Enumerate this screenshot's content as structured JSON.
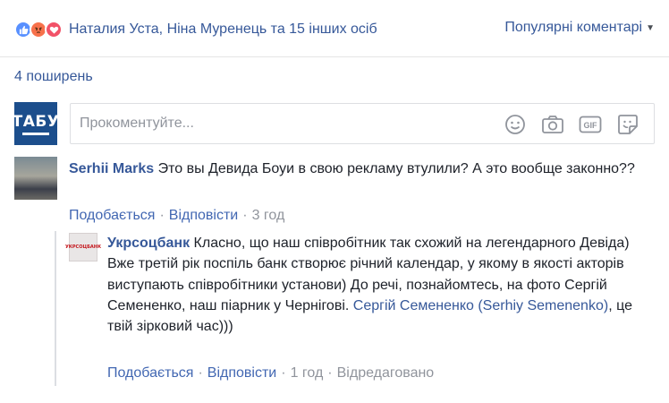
{
  "reactions": {
    "icons": [
      "like-icon",
      "angry-icon",
      "love-icon"
    ],
    "names": "Наталия Уста, Ніна Муренець",
    "joiner": " та ",
    "others": "15 інших осіб"
  },
  "sort": {
    "label": "Популярні коментарі",
    "caret": "▼"
  },
  "shares": "4 поширень",
  "composer": {
    "avatar_text": "ТАБУ",
    "placeholder": "Прокоментуйте...",
    "icons": [
      "emoji-icon",
      "camera-icon",
      "gif-icon",
      "sticker-icon"
    ],
    "gif_text": "GIF"
  },
  "comment": {
    "author": "Serhii Marks",
    "text": " Это вы Девида Боуи в свою рекламу втулили? А это вообще законно??",
    "like": "Подобається",
    "reply": "Відповісти",
    "time": "3 год",
    "sep": "·"
  },
  "reply": {
    "avatar_text": "УКРСОЦБАНК",
    "author": "Укрсоцбанк",
    "text": " Класно, що наш співробітник так схожий на легендарного Девіда) Вже третій рік поспіль банк створює річний календар, у якому в якості акторів виступають співробітники установи) До речі, познайомтесь, на фото Сергій Семененко, наш піарник у Чернігові. ",
    "mention": "Сергій Семененко (Serhiy Semenenko)",
    "text_end": ", це твій зірковий час)))",
    "like": "Подобається",
    "reply_label": "Відповісти",
    "time": "1 год",
    "edited": "Відредаговано",
    "sep": "·"
  },
  "colors": {
    "link": "#365899",
    "action": "#4267b2",
    "muted": "#90949c",
    "like": "#5890ff",
    "angry": "#f7714b",
    "love": "#f25268"
  }
}
